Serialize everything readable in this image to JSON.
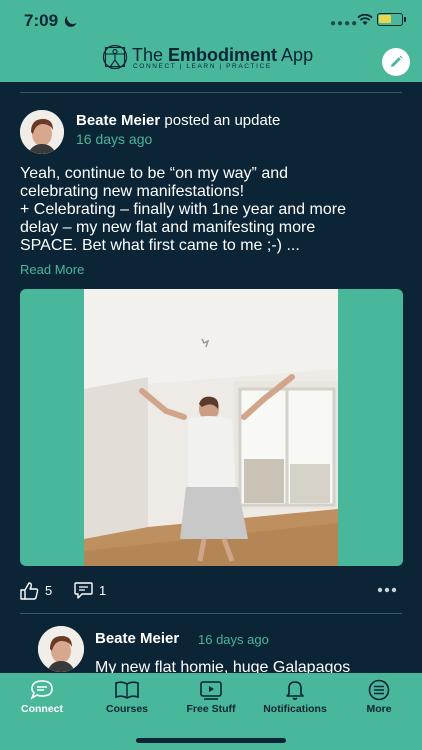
{
  "status_bar": {
    "time": "7:09"
  },
  "header": {
    "brand_prefix": "The ",
    "brand_bold": "Embodiment",
    "brand_suffix": " App",
    "tagline": "CONNECT | LEARN | PRACTICE",
    "edit_icon": "pencil-icon"
  },
  "post": {
    "author": "Beate Meier",
    "action": " posted an update",
    "time": "16 days ago",
    "text_lines": [
      "Yeah, continue to be “on my way” and",
      "celebrating new manifestations!",
      "+ Celebrating – finally with 1ne year and more",
      "delay – my new flat and manifesting more",
      "SPACE. Bet what first came to me ;-) ..."
    ],
    "read_more": "Read More",
    "likes": "5",
    "comments": "1",
    "more_icon": "ellipsis-icon"
  },
  "comment": {
    "author": "Beate Meier",
    "time": "16 days ago",
    "text": "My new flat homie, huge Galapagos"
  },
  "tabs": [
    {
      "label": "Connect",
      "icon": "chat-icon",
      "active": true
    },
    {
      "label": "Courses",
      "icon": "book-icon",
      "active": false
    },
    {
      "label": "Free Stuff",
      "icon": "video-icon",
      "active": false
    },
    {
      "label": "Notifications",
      "icon": "bell-icon",
      "active": false
    },
    {
      "label": "More",
      "icon": "menu-icon",
      "active": false
    }
  ],
  "colors": {
    "accent": "#48b79a",
    "background": "#0b2436",
    "text": "#ffffff"
  }
}
